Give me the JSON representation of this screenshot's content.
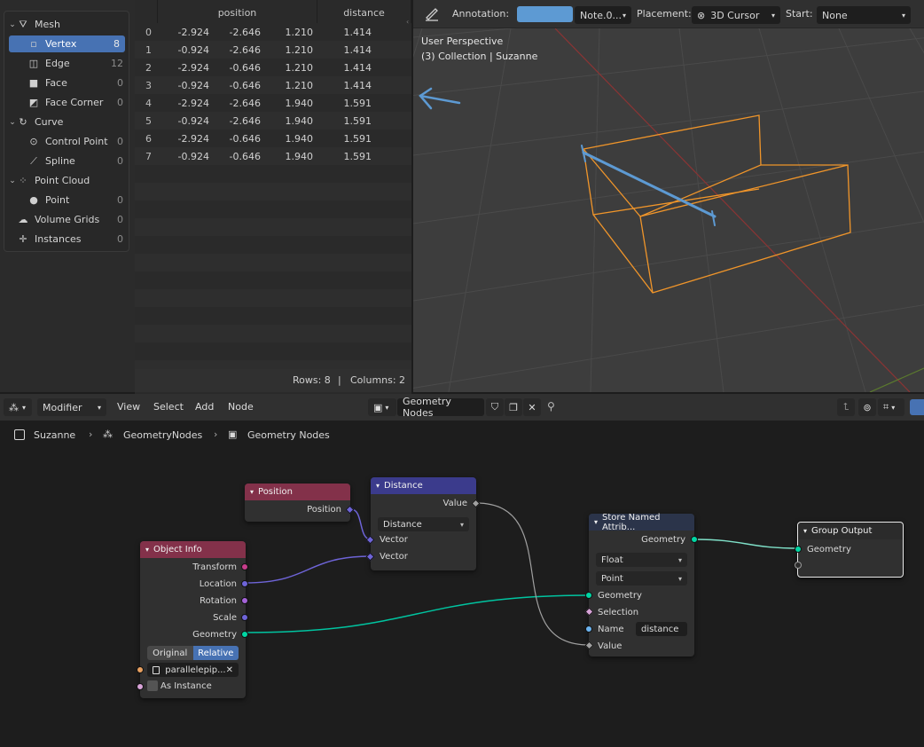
{
  "outliner": {
    "items": [
      {
        "label": "Mesh",
        "count": "",
        "level": 0,
        "chev": "v",
        "icon": "mesh-icon"
      },
      {
        "label": "Vertex",
        "count": "8",
        "level": 1,
        "chev": "",
        "icon": "vertex-icon",
        "selected": true
      },
      {
        "label": "Edge",
        "count": "12",
        "level": 1,
        "chev": "",
        "icon": "edge-icon"
      },
      {
        "label": "Face",
        "count": "0",
        "level": 1,
        "chev": "",
        "icon": "face-icon"
      },
      {
        "label": "Face Corner",
        "count": "0",
        "level": 1,
        "chev": "",
        "icon": "face-corner-icon"
      },
      {
        "label": "Curve",
        "count": "",
        "level": 0,
        "chev": "v",
        "icon": "curve-icon"
      },
      {
        "label": "Control Point",
        "count": "0",
        "level": 1,
        "chev": "",
        "icon": "control-point-icon"
      },
      {
        "label": "Spline",
        "count": "0",
        "level": 1,
        "chev": "",
        "icon": "spline-icon"
      },
      {
        "label": "Point Cloud",
        "count": "",
        "level": 0,
        "chev": "v",
        "icon": "point-cloud-icon"
      },
      {
        "label": "Point",
        "count": "0",
        "level": 1,
        "chev": "",
        "icon": "point-icon"
      },
      {
        "label": "Volume Grids",
        "count": "0",
        "level": 0,
        "chev": "",
        "icon": "volume-icon"
      },
      {
        "label": "Instances",
        "count": "0",
        "level": 0,
        "chev": "",
        "icon": "instances-icon"
      }
    ]
  },
  "spreadsheet": {
    "columns": [
      "position",
      "distance"
    ],
    "rows": [
      {
        "i": "0",
        "x": "-2.924",
        "y": "-2.646",
        "z": "1.210",
        "d": "1.414"
      },
      {
        "i": "1",
        "x": "-0.924",
        "y": "-2.646",
        "z": "1.210",
        "d": "1.414"
      },
      {
        "i": "2",
        "x": "-2.924",
        "y": "-0.646",
        "z": "1.210",
        "d": "1.414"
      },
      {
        "i": "3",
        "x": "-0.924",
        "y": "-0.646",
        "z": "1.210",
        "d": "1.414"
      },
      {
        "i": "4",
        "x": "-2.924",
        "y": "-2.646",
        "z": "1.940",
        "d": "1.591"
      },
      {
        "i": "5",
        "x": "-0.924",
        "y": "-2.646",
        "z": "1.940",
        "d": "1.591"
      },
      {
        "i": "6",
        "x": "-2.924",
        "y": "-0.646",
        "z": "1.940",
        "d": "1.591"
      },
      {
        "i": "7",
        "x": "-0.924",
        "y": "-0.646",
        "z": "1.940",
        "d": "1.591"
      }
    ],
    "rows_label": "Rows: 8",
    "separator": "|",
    "columns_label": "Columns: 2"
  },
  "viewport": {
    "annotation_label": "Annotation:",
    "annotation_color": "#5d9ad3",
    "note_value": "Note.0...",
    "placement_label": "Placement:",
    "placement_value": "3D Cursor",
    "start_label": "Start:",
    "start_value": "None",
    "perspective": "User Perspective",
    "collection": "(3) Collection | Suzanne",
    "box_color": "#f0952a",
    "annotation_stroke": "#5d9ad3"
  },
  "node_editor": {
    "editor_type": "Modifier",
    "menus": [
      "View",
      "Select",
      "Add",
      "Node"
    ],
    "tree_name": "Geometry Nodes",
    "breadcrumb": [
      "Suzanne",
      "GeometryNodes",
      "Geometry Nodes"
    ],
    "nodes": {
      "position": {
        "title": "Position",
        "out": "Position",
        "color": "#83314a"
      },
      "distance": {
        "title": "Distance",
        "out": "Value",
        "mode": "Distance",
        "in1": "Vector",
        "in2": "Vector",
        "color": "#3b3b8c"
      },
      "object_info": {
        "title": "Object Info",
        "outputs": [
          "Transform",
          "Location",
          "Rotation",
          "Scale",
          "Geometry"
        ],
        "opt_original": "Original",
        "opt_relative": "Relative",
        "object": "parallelepip...",
        "as_instance": "As Instance",
        "color": "#83314a"
      },
      "store": {
        "title": "Store Named Attrib...",
        "out": "Geometry",
        "type": "Float",
        "domain": "Point",
        "in_geometry": "Geometry",
        "in_selection": "Selection",
        "in_name": "Name",
        "name_value": "distance",
        "in_value": "Value",
        "color": "#2b344a"
      },
      "group_output": {
        "title": "Group Output",
        "in_geometry": "Geometry",
        "color": "#2b2b2b"
      }
    }
  }
}
